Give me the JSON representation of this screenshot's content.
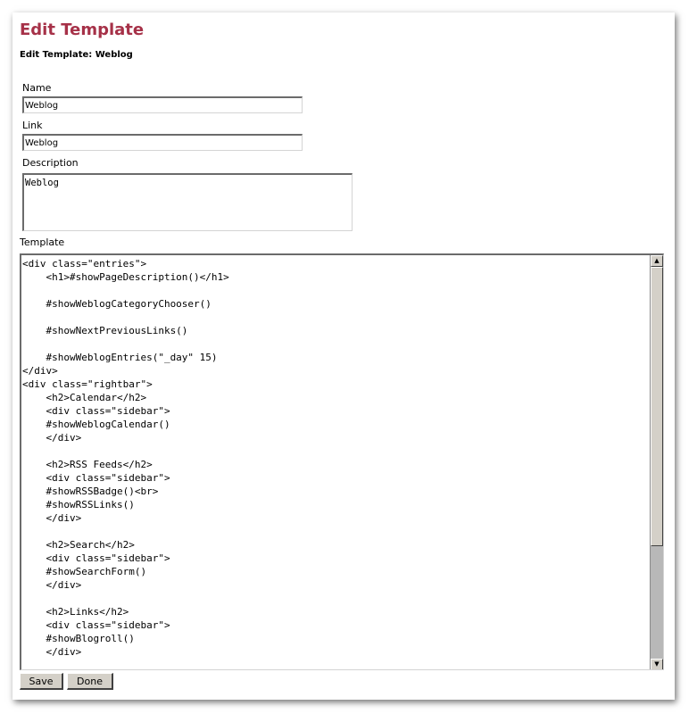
{
  "header": {
    "title": "Edit Template",
    "subtitle": "Edit Template: Weblog"
  },
  "form": {
    "name_label": "Name",
    "name_value": "Weblog",
    "link_label": "Link",
    "link_value": "Weblog",
    "description_label": "Description",
    "description_value": "Weblog",
    "template_label": "Template",
    "template_value": "<div class=\"entries\">\n    <h1>#showPageDescription()</h1>\n\n    #showWeblogCategoryChooser()\n\n    #showNextPreviousLinks()\n\n    #showWeblogEntries(\"_day\" 15)\n</div>\n<div class=\"rightbar\">\n    <h2>Calendar</h2>\n    <div class=\"sidebar\">\n    #showWeblogCalendar()\n    </div>\n\n    <h2>RSS Feeds</h2>\n    <div class=\"sidebar\">\n    #showRSSBadge()<br>\n    #showRSSLinks()\n    </div>\n\n    <h2>Search</h2>\n    <div class=\"sidebar\">\n    #showSearchForm()\n    </div>\n\n    <h2>Links</h2>\n    <div class=\"sidebar\">\n    #showBlogroll()\n    </div>\n"
  },
  "buttons": {
    "save_label": "Save",
    "done_label": "Done"
  },
  "scrollbar": {
    "up_icon": "▲",
    "down_icon": "▼"
  },
  "colors": {
    "title": "#a63148",
    "button_face": "#d4d0c8"
  }
}
